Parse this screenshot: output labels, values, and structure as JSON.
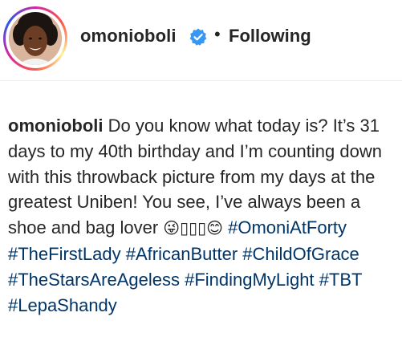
{
  "header": {
    "username": "omonioboli",
    "separator": "•",
    "follow_status": "Following",
    "verified_icon": "verified-badge-icon",
    "colors": {
      "verified": "#3897f0",
      "text": "#262626",
      "hashtag": "#003569"
    }
  },
  "caption": {
    "username": "omonioboli",
    "lines": [
      "Do you know what today is? It’s",
      "31 days to my 40th birthday and I’m",
      "counting down with this throwback picture",
      "from my days at the greatest Uniben! You",
      "see, I’ve always been a shoe and bag lover"
    ],
    "emojis": "😜▯▯▯😊",
    "hashtags": [
      "#OmoniAtForty",
      "#TheFirstLady",
      "#AfricanButter",
      "#ChildOfGrace",
      "#TheStarsAreAgeless",
      "#FindingMyLight",
      "#TBT",
      "#LepaShandy"
    ]
  }
}
